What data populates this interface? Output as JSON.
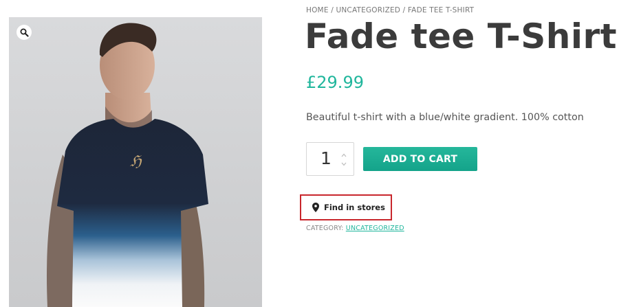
{
  "breadcrumb": {
    "home": "Home",
    "sep1": " / ",
    "category": "Uncategorized",
    "sep2": " / ",
    "current": "Fade tee T-Shirt"
  },
  "product": {
    "title": "Fade tee T-Shirt",
    "price": "£29.99",
    "description": "Beautiful t-shirt with a blue/white gradient. 100% cotton",
    "quantity": "1",
    "add_to_cart_label": "ADD TO CART",
    "find_in_stores_label": "Find in stores",
    "category_label": "CATEGORY: ",
    "category_value": "UNCATEGORIZED"
  },
  "icons": {
    "zoom": "magnifier-icon",
    "location": "map-pin-icon",
    "qty_up": "chevron-up-icon",
    "qty_down": "chevron-down-icon"
  },
  "colors": {
    "accent": "#20b69c",
    "button": "#1aad92",
    "highlight_border": "#c8262c",
    "title": "#3b3b3b"
  }
}
